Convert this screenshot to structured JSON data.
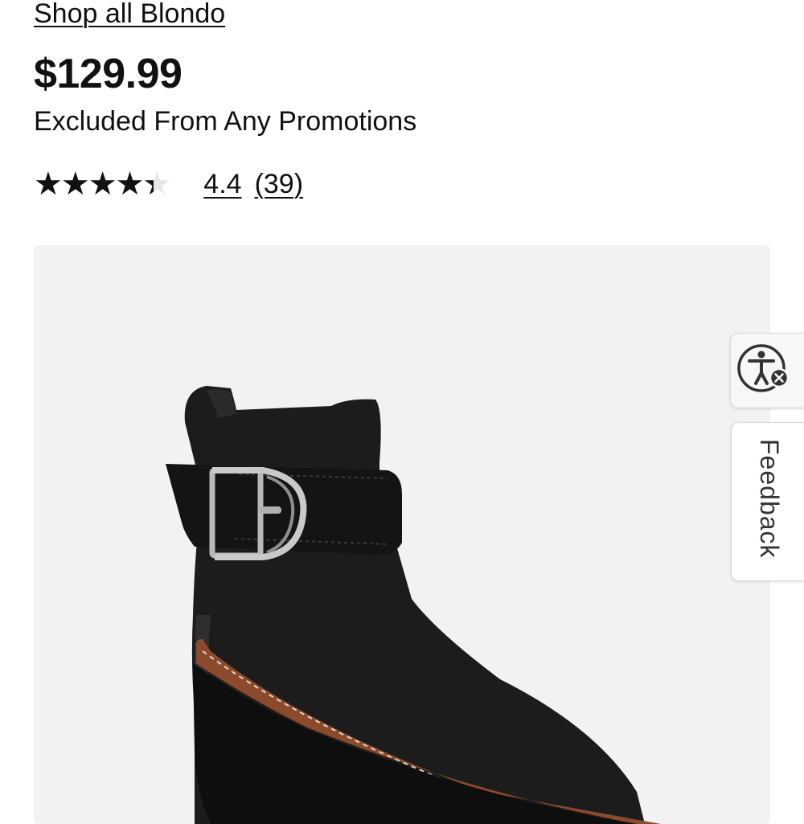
{
  "brand_link": {
    "label": "Shop all Blondo"
  },
  "price": "$129.99",
  "promo_note": "Excluded From Any Promotions",
  "rating": {
    "stars_glyphs": "★★★★★",
    "average": 4.4,
    "max": 5,
    "value_label": "4.4",
    "count_label": "(39)"
  },
  "product_image": {
    "icon": "black-ankle-boot-with-buckle"
  },
  "side_tabs": {
    "accessibility_icon": "accessibility-person-icon",
    "feedback_label": "Feedback"
  },
  "colors": {
    "text": "#111111",
    "image_bg": "#f3f2f2",
    "boot": "#1c1c1c",
    "sole_trim": "#8b4a2b"
  }
}
